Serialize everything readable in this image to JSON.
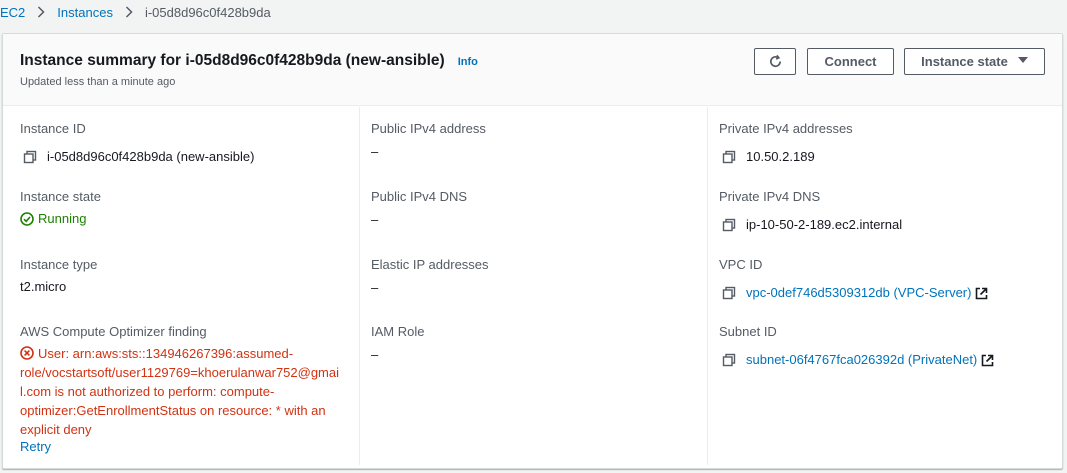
{
  "breadcrumb": {
    "items": [
      "EC2",
      "Instances"
    ],
    "current": "i-05d8d96c0f428b9da"
  },
  "header": {
    "title": "Instance summary for i-05d8d96c0f428b9da (new-ansible)",
    "info_label": "Info",
    "updated": "Updated less than a minute ago",
    "connect_label": "Connect",
    "instance_state_label": "Instance state"
  },
  "details": {
    "instance_id": {
      "label": "Instance ID",
      "value": "i-05d8d96c0f428b9da (new-ansible)"
    },
    "instance_state": {
      "label": "Instance state",
      "value": "Running"
    },
    "instance_type": {
      "label": "Instance type",
      "value": "t2.micro"
    },
    "optimizer": {
      "label": "AWS Compute Optimizer finding",
      "error_lines": [
        "User: arn:aws:sts::134946267396:assumed-",
        "role/vocstartsoft/user1129769=khoerulanwar752@gmai",
        "l.com is not authorized to perform: compute-",
        "optimizer:GetEnrollmentStatus on resource: * with an",
        "explicit deny"
      ],
      "retry_label": "Retry"
    },
    "public_ipv4": {
      "label": "Public IPv4 address",
      "value": "–"
    },
    "public_dns": {
      "label": "Public IPv4 DNS",
      "value": "–"
    },
    "elastic_ip": {
      "label": "Elastic IP addresses",
      "value": "–"
    },
    "iam_role": {
      "label": "IAM Role",
      "value": "–"
    },
    "private_ipv4": {
      "label": "Private IPv4 addresses",
      "value": "10.50.2.189"
    },
    "private_dns": {
      "label": "Private IPv4 DNS",
      "value": "ip-10-50-2-189.ec2.internal"
    },
    "vpc_id": {
      "label": "VPC ID",
      "value": "vpc-0def746d5309312db (VPC-Server)"
    },
    "subnet_id": {
      "label": "Subnet ID",
      "value": "subnet-06f4767fca026392d (PrivateNet)"
    }
  },
  "icons": {
    "refresh": "refresh-icon",
    "copy": "copy-icon",
    "external": "external-link-icon",
    "success": "status-success-icon",
    "error": "status-error-icon",
    "caret": "caret-down-icon",
    "chevron": "chevron-right-icon"
  },
  "colors": {
    "link": "#0073bb",
    "success": "#1d8102",
    "error": "#d13212",
    "text": "#16191f",
    "secondary": "#545b64"
  }
}
